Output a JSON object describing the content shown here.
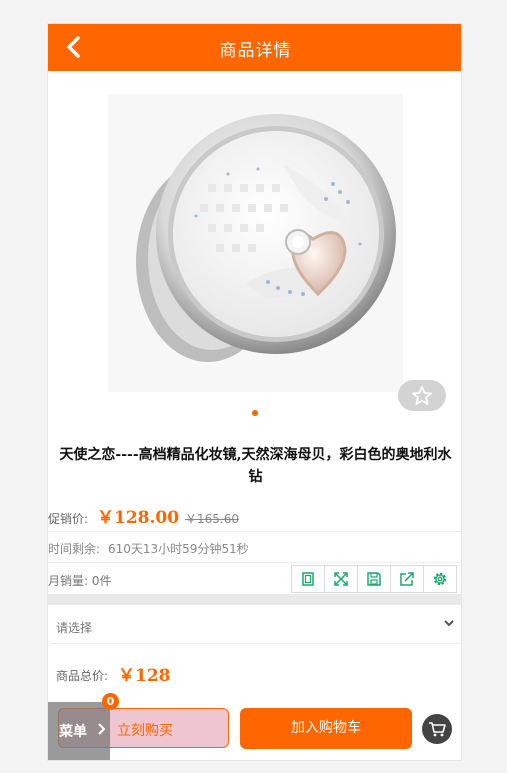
{
  "header": {
    "title": "商品详情",
    "back_icon": "chevron-left-icon"
  },
  "product": {
    "title": "天使之恋----高档精品化妆镜,天然深海母贝，彩白色的奥地利水钻",
    "promo_label": "促销价:",
    "promo_price": "￥128.00",
    "original_price": "￥165.60",
    "time_left_label": "时间剩余:",
    "time_left_value": "610天13小时59分钟51秒",
    "monthly_sales": "月销量: 0件"
  },
  "tools": [
    "copy-icon",
    "fullscreen-icon",
    "save-icon",
    "share-icon",
    "settings-icon"
  ],
  "options": {
    "placeholder": "请选择"
  },
  "total": {
    "label": "商品总价:",
    "value": "￥128"
  },
  "footer": {
    "buy_now": "立刻购买",
    "add_to_cart": "加入购物车",
    "menu": "菜单",
    "cart_count": "0"
  },
  "colors": {
    "accent": "#ff6600",
    "buy_now_bg": "#efc5cf"
  }
}
